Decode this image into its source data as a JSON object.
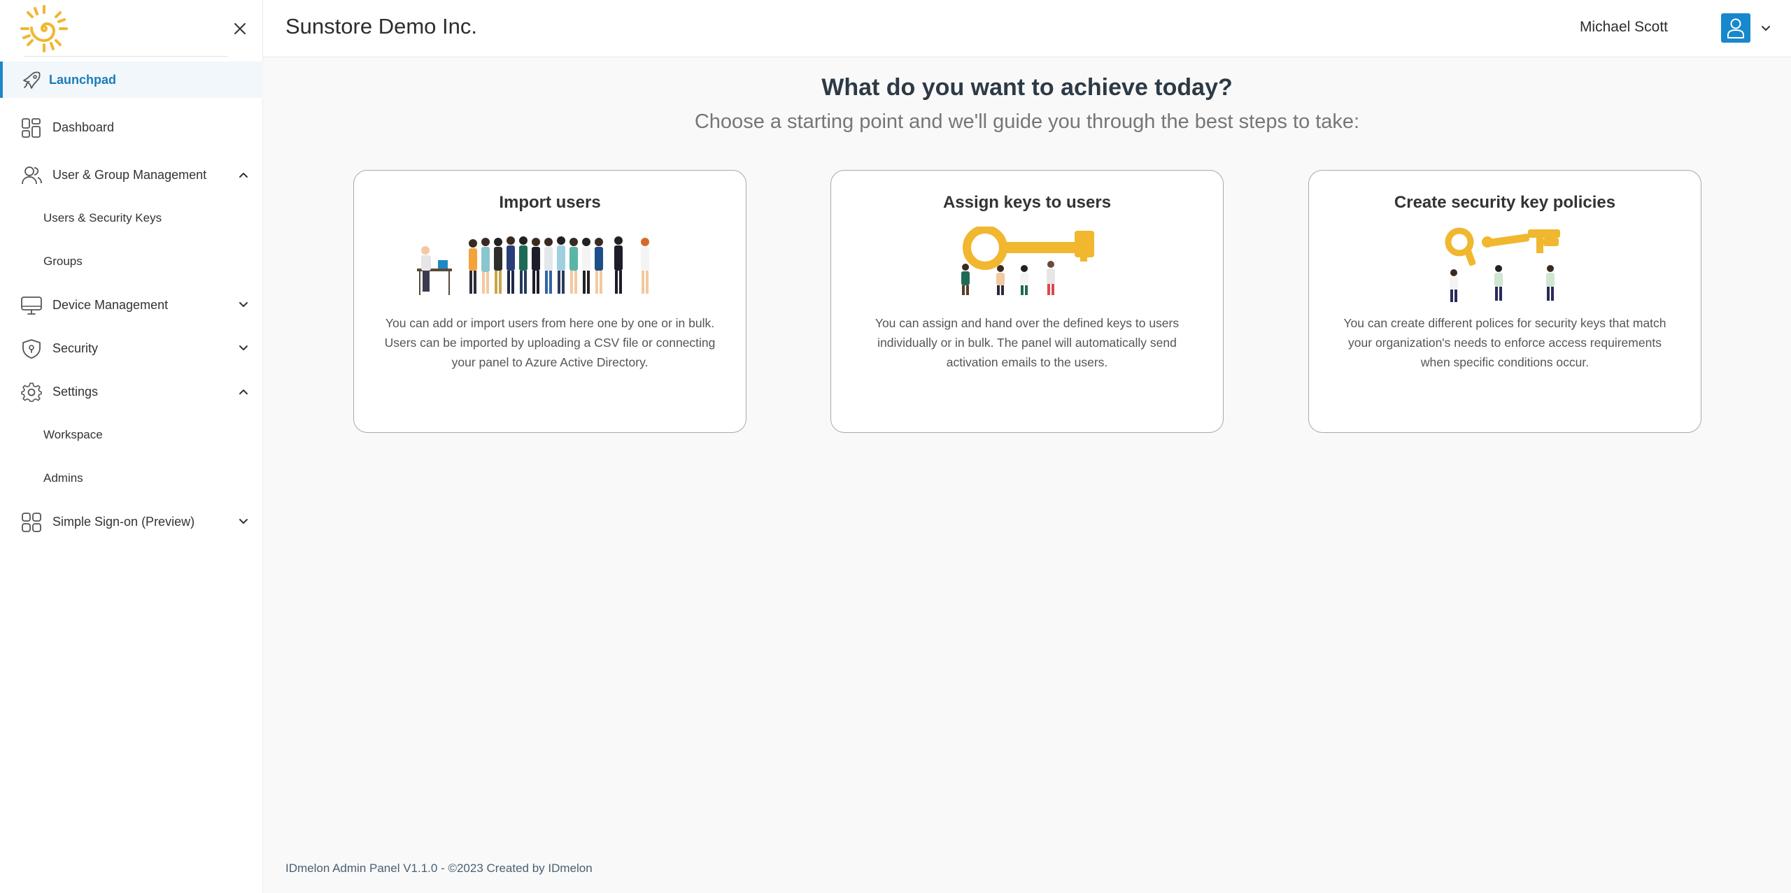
{
  "app": {
    "title": "Sunstore Demo Inc."
  },
  "user": {
    "name": "Michael Scott"
  },
  "colors": {
    "accent": "#1e88c7",
    "avatar": "#1888cc",
    "gold": "#f0b72f"
  },
  "sidebar": {
    "items": [
      {
        "label": "Launchpad",
        "icon": "rocket-icon"
      },
      {
        "label": "Dashboard",
        "icon": "dashboard-icon"
      },
      {
        "label": "User & Group Management",
        "icon": "users-icon",
        "expanded": true
      },
      {
        "label": "Users & Security Keys"
      },
      {
        "label": "Groups"
      },
      {
        "label": "Device Management",
        "icon": "monitor-icon",
        "expanded": false
      },
      {
        "label": "Security",
        "icon": "shield-icon",
        "expanded": false
      },
      {
        "label": "Settings",
        "icon": "gear-icon",
        "expanded": true
      },
      {
        "label": "Workspace"
      },
      {
        "label": "Admins"
      },
      {
        "label": "Simple Sign-on (Preview)",
        "icon": "apps-icon",
        "expanded": false
      }
    ]
  },
  "main": {
    "heading": "What do you want to achieve today?",
    "subheading": "Choose a starting point and we'll guide you through the best steps to take:",
    "cards": [
      {
        "title": "Import users",
        "illustration": "people-crowd-illustration",
        "description": "You can add or import users from here one by one or in bulk. Users can be imported by uploading a CSV file or connecting your panel to Azure Active Directory."
      },
      {
        "title": "Assign keys to users",
        "illustration": "people-carrying-key-illustration",
        "description": "You can assign and hand over the defined keys to users individually or in bulk. The panel will automatically send activation emails to the users."
      },
      {
        "title": "Create security key policies",
        "illustration": "people-with-keys-illustration",
        "description": "You can create different polices for security keys that match your organization's needs to enforce access requirements when specific conditions occur."
      }
    ]
  },
  "footer": {
    "text": "IDmelon Admin Panel V1.1.0 - ©2023 Created by IDmelon"
  }
}
